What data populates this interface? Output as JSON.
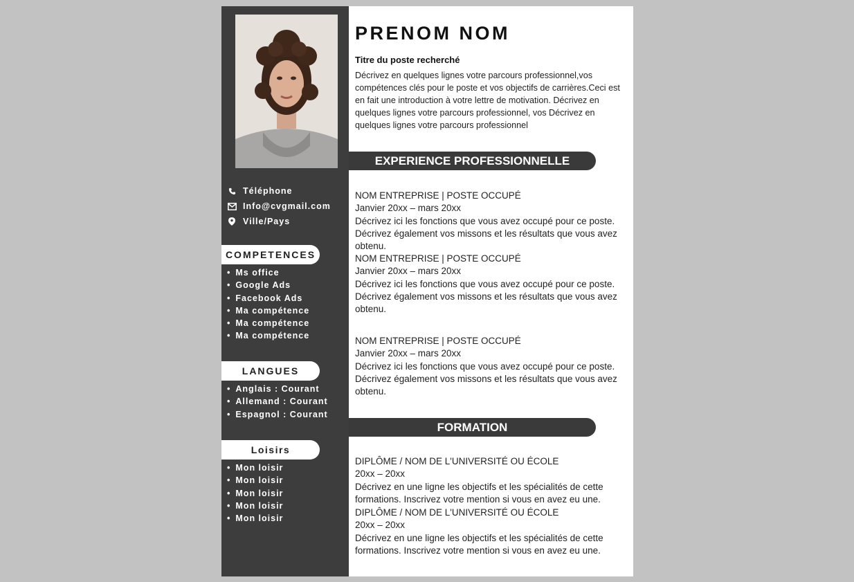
{
  "header": {
    "name": "PRENOM NOM",
    "job_title": "Titre du poste recherché",
    "intro": "Décrivez en quelques lignes votre parcours professionnel,vos compétences clés pour le poste et vos objectifs de carrières.Ceci est en fait une introduction à votre lettre de motivation. Décrivez en quelques lignes votre parcours professionnel, vos Décrivez en quelques lignes votre parcours professionnel"
  },
  "contact": [
    {
      "icon": "phone-icon",
      "text": "Téléphone"
    },
    {
      "icon": "envelope-icon",
      "text": "Info@cvgmail.com"
    },
    {
      "icon": "map-pin-icon",
      "text": "Ville/Pays"
    }
  ],
  "competences": {
    "title": "COMPETENCES",
    "items": [
      "Ms office",
      "Google Ads",
      "Facebook Ads",
      "Ma compétence",
      "Ma compétence",
      "Ma compétence"
    ]
  },
  "langues": {
    "title": "LANGUES",
    "items": [
      "Anglais : Courant",
      "Allemand : Courant",
      "Espagnol : Courant"
    ]
  },
  "loisirs": {
    "title": "Loisirs",
    "items": [
      "Mon loisir",
      "Mon loisir",
      "Mon loisir",
      "Mon loisir",
      "Mon loisir"
    ]
  },
  "experience": {
    "title": "EXPERIENCE PROFESSIONNELLE",
    "entries": [
      {
        "heading": "NOM ENTREPRISE | POSTE OCCUPÉ",
        "dates": "Janvier 20xx – mars 20xx",
        "desc": "Décrivez ici les fonctions que vous avez occupé pour ce poste. Décrivez également vos missons et les résultats que vous avez obtenu."
      },
      {
        "heading": "NOM ENTREPRISE | POSTE OCCUPÉ",
        "dates": "Janvier 20xx – mars 20xx",
        "desc": "Décrivez ici les fonctions que vous avez occupé pour ce poste. Décrivez également vos missons et les résultats que vous avez obtenu."
      },
      {
        "heading": "NOM ENTREPRISE | POSTE OCCUPÉ",
        "dates": "Janvier 20xx – mars 20xx",
        "desc": "Décrivez ici les fonctions que vous avez occupé pour ce poste. Décrivez également vos missons et les résultats que vous avez obtenu."
      }
    ]
  },
  "formation": {
    "title": "FORMATION",
    "entries": [
      {
        "heading": "DIPLÔME / NOM DE L'UNIVERSITÉ OU ÉCOLE",
        "dates": "20xx – 20xx",
        "desc": "Décrivez en une ligne les objectifs et les spécialités de cette formations. Inscrivez votre mention si vous en avez eu une."
      },
      {
        "heading": "DIPLÔME / NOM DE L'UNIVERSITÉ OU ÉCOLE",
        "dates": "20xx – 20xx",
        "desc": "Décrivez en une ligne les objectifs et les spécialités de cette formations. Inscrivez votre mention si vous en avez eu une."
      }
    ]
  },
  "colors": {
    "sidebar": "#3d3d3d",
    "background": "#c2c2c2",
    "page": "#ffffff",
    "section_bar": "#3a3a3a"
  }
}
